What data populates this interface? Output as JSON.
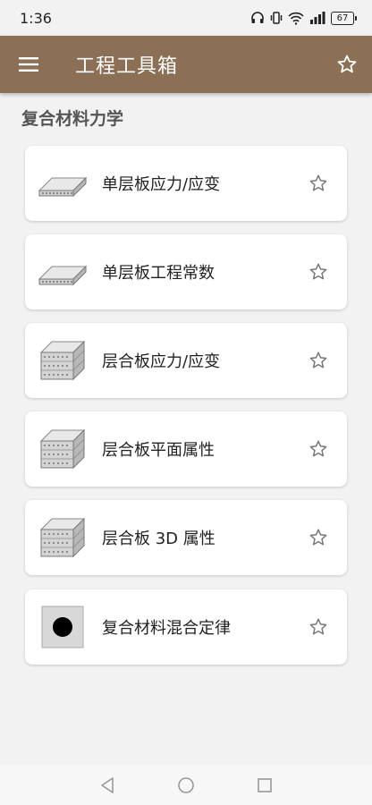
{
  "status_bar": {
    "time": "1:36",
    "battery": "67",
    "icons": [
      "headphones-icon",
      "vibrate-icon",
      "wifi-icon",
      "signal-icon",
      "battery-icon"
    ]
  },
  "app_bar": {
    "title": "工程工具箱",
    "menu_icon": "menu-icon",
    "action_icon": "star-outline-icon",
    "background": "#8b7055"
  },
  "section": {
    "title": "复合材料力学"
  },
  "items": [
    {
      "label": "单层板应力/应变",
      "icon": "single-ply-icon"
    },
    {
      "label": "单层板工程常数",
      "icon": "single-ply-icon"
    },
    {
      "label": "层合板应力/应变",
      "icon": "laminate-icon"
    },
    {
      "label": "层合板平面属性",
      "icon": "laminate-icon"
    },
    {
      "label": "层合板 3D 属性",
      "icon": "laminate-icon"
    },
    {
      "label": "复合材料混合定律",
      "icon": "fiber-matrix-icon"
    }
  ],
  "nav_bar": {
    "icons": [
      "back-triangle-icon",
      "home-circle-icon",
      "recents-square-icon"
    ]
  },
  "colors": {
    "app_bar": "#8b7055",
    "background": "#f2f2f2",
    "card": "#ffffff"
  }
}
